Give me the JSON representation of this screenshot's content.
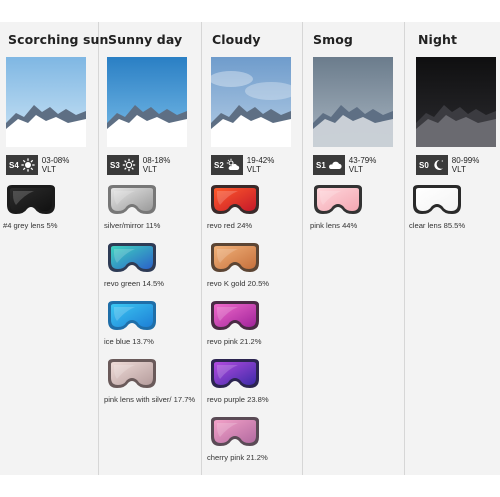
{
  "columns": [
    {
      "title": "Scorching sun",
      "category": "S4",
      "vlt_range": "03-08%",
      "vlt_label": "VLT",
      "icon": "bright-sun-icon",
      "sky": [
        "#7fb7e3",
        "#cfe6f6"
      ],
      "lenses": [
        {
          "label": "#4 grey lens  5%",
          "frame": "#1b1b1b",
          "fill": [
            "#2c2c2c",
            "#111111"
          ]
        }
      ]
    },
    {
      "title": "Sunny day",
      "category": "S3",
      "vlt_range": "08-18%",
      "vlt_label": "VLT",
      "icon": "sun-icon",
      "sky": [
        "#2a7fc4",
        "#7ec0ea"
      ],
      "lenses": [
        {
          "label": "silver/mirror 11%",
          "frame": "#777777",
          "fill": [
            "#e6e6e6",
            "#9a9a9a"
          ]
        },
        {
          "label": "revo green  14.5%",
          "frame": "#2e3b55",
          "fill": [
            "#3fd3c0",
            "#2b62c9"
          ]
        },
        {
          "label": "ice blue  13.7%",
          "frame": "#1f6ea8",
          "fill": [
            "#3cc7f2",
            "#1d7fd6"
          ]
        },
        {
          "label": "pink lens with  silver/ 17.7%",
          "frame": "#6a5a5a",
          "fill": [
            "#efdcd8",
            "#b59c9c"
          ]
        }
      ]
    },
    {
      "title": "Cloudy",
      "category": "S2",
      "vlt_range": "19-42%",
      "vlt_label": "VLT",
      "icon": "sun-cloud-icon",
      "sky": [
        "#6f9ccc",
        "#b7cfe6"
      ],
      "lenses": [
        {
          "label": "revo red  24%",
          "frame": "#3a2a2a",
          "fill": [
            "#ff5a2b",
            "#c5182a"
          ]
        },
        {
          "label": "revo K gold  20.5%",
          "frame": "#5c4534",
          "fill": [
            "#f1b27a",
            "#c6703c"
          ]
        },
        {
          "label": "revo pink 21.2%",
          "frame": "#4a2a44",
          "fill": [
            "#f06acb",
            "#a0239a"
          ]
        },
        {
          "label": "revo purple  23.8%",
          "frame": "#2b2450",
          "fill": [
            "#b24be0",
            "#3d2aa8"
          ]
        },
        {
          "label": "cherry pink 21.2%",
          "frame": "#5a4a55",
          "fill": [
            "#f3a1c8",
            "#b26aa0"
          ]
        }
      ]
    },
    {
      "title": "Smog",
      "category": "S1",
      "vlt_range": "43-79%",
      "vlt_label": "VLT",
      "icon": "cloud-icon",
      "sky": [
        "#6b7c8c",
        "#a9b6c2"
      ],
      "lenses": [
        {
          "label": "pink lens 44%",
          "frame": "#333333",
          "fill": [
            "#ffd7dc",
            "#f3a7b2"
          ]
        }
      ]
    },
    {
      "title": "Night",
      "category": "S0",
      "vlt_range": "80-99%",
      "vlt_label": "VLT",
      "icon": "moon-icon",
      "sky": [
        "#0f0f10",
        "#2c2c30"
      ],
      "lenses": [
        {
          "label": "clear lens 85.5%",
          "frame": "#2a2a2a",
          "fill": [
            "#ffffff",
            "#f4f4f4"
          ]
        }
      ]
    }
  ]
}
